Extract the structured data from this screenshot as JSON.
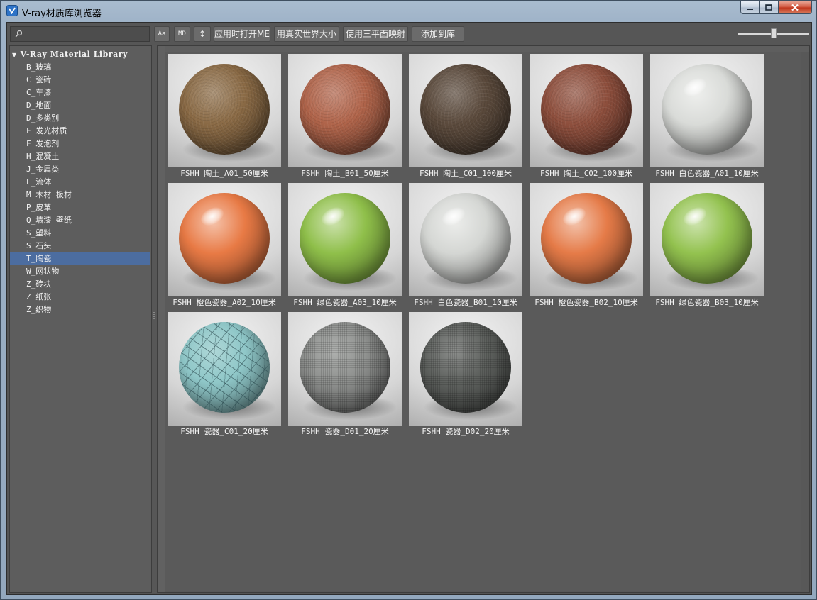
{
  "window": {
    "title": "V-ray材质库浏览器"
  },
  "toolbar": {
    "search_placeholder": "",
    "btn_font": "Aa",
    "btn_md": "MD",
    "btn_sort": "↕",
    "btn_apply_open_me": "应用时打开ME",
    "btn_real_world_size": "用真实世界大小",
    "btn_triplanar": "使用三平面映射",
    "btn_add_to_library": "添加到库",
    "thumbnail_size": 0.5
  },
  "tree": {
    "root_label": "V-Ray Material Library",
    "items": [
      {
        "label": "B_玻璃"
      },
      {
        "label": "C_瓷砖"
      },
      {
        "label": "C_车漆"
      },
      {
        "label": "D_地面"
      },
      {
        "label": "D_多类别"
      },
      {
        "label": "F_发光材质"
      },
      {
        "label": "F_发泡剂"
      },
      {
        "label": "H_混凝土"
      },
      {
        "label": "J_金属类"
      },
      {
        "label": "L_流体"
      },
      {
        "label": "M_木材 板材"
      },
      {
        "label": "P_皮革"
      },
      {
        "label": "Q_墙漆 壁纸"
      },
      {
        "label": "S_塑料"
      },
      {
        "label": "S_石头"
      },
      {
        "label": "T_陶瓷"
      },
      {
        "label": "W_网状物"
      },
      {
        "label": "Z_砖块"
      },
      {
        "label": "Z_纸张"
      },
      {
        "label": "Z_织物"
      }
    ],
    "selected_label": "T_陶瓷"
  },
  "materials": [
    {
      "label": "FSHH 陶土_A01_50厘米",
      "color": "#8a6a45",
      "finish": "rough"
    },
    {
      "label": "FSHH 陶土_B01_50厘米",
      "color": "#b0644a",
      "finish": "rough"
    },
    {
      "label": "FSHH 陶土_C01_100厘米",
      "color": "#5b4a3c",
      "finish": "rough"
    },
    {
      "label": "FSHH 陶土_C02_100厘米",
      "color": "#8e4f3d",
      "finish": "rough"
    },
    {
      "label": "FSHH 白色瓷器_A01_10厘米",
      "color": "#d9dbd8",
      "finish": "glossy"
    },
    {
      "label": "FSHH 橙色瓷器_A02_10厘米",
      "color": "#e87a45",
      "finish": "glossy"
    },
    {
      "label": "FSHH 绿色瓷器_A03_10厘米",
      "color": "#8fbf4a",
      "finish": "glossy"
    },
    {
      "label": "FSHH 白色瓷器_B01_10厘米",
      "color": "#d4d6d3",
      "finish": "glossy"
    },
    {
      "label": "FSHH 橙色瓷器_B02_10厘米",
      "color": "#e57b48",
      "finish": "glossy"
    },
    {
      "label": "FSHH 绿色瓷器_B03_10厘米",
      "color": "#93c24f",
      "finish": "glossy"
    },
    {
      "label": "FSHH 瓷器_C01_20厘米",
      "color": "#8fc7c8",
      "finish": "crackle"
    },
    {
      "label": "FSHH 瓷器_D01_20厘米",
      "color": "#8f918f",
      "finish": "mesh"
    },
    {
      "label": "FSHH 瓷器_D02_20厘米",
      "color": "#5f625f",
      "finish": "mesh"
    }
  ]
}
